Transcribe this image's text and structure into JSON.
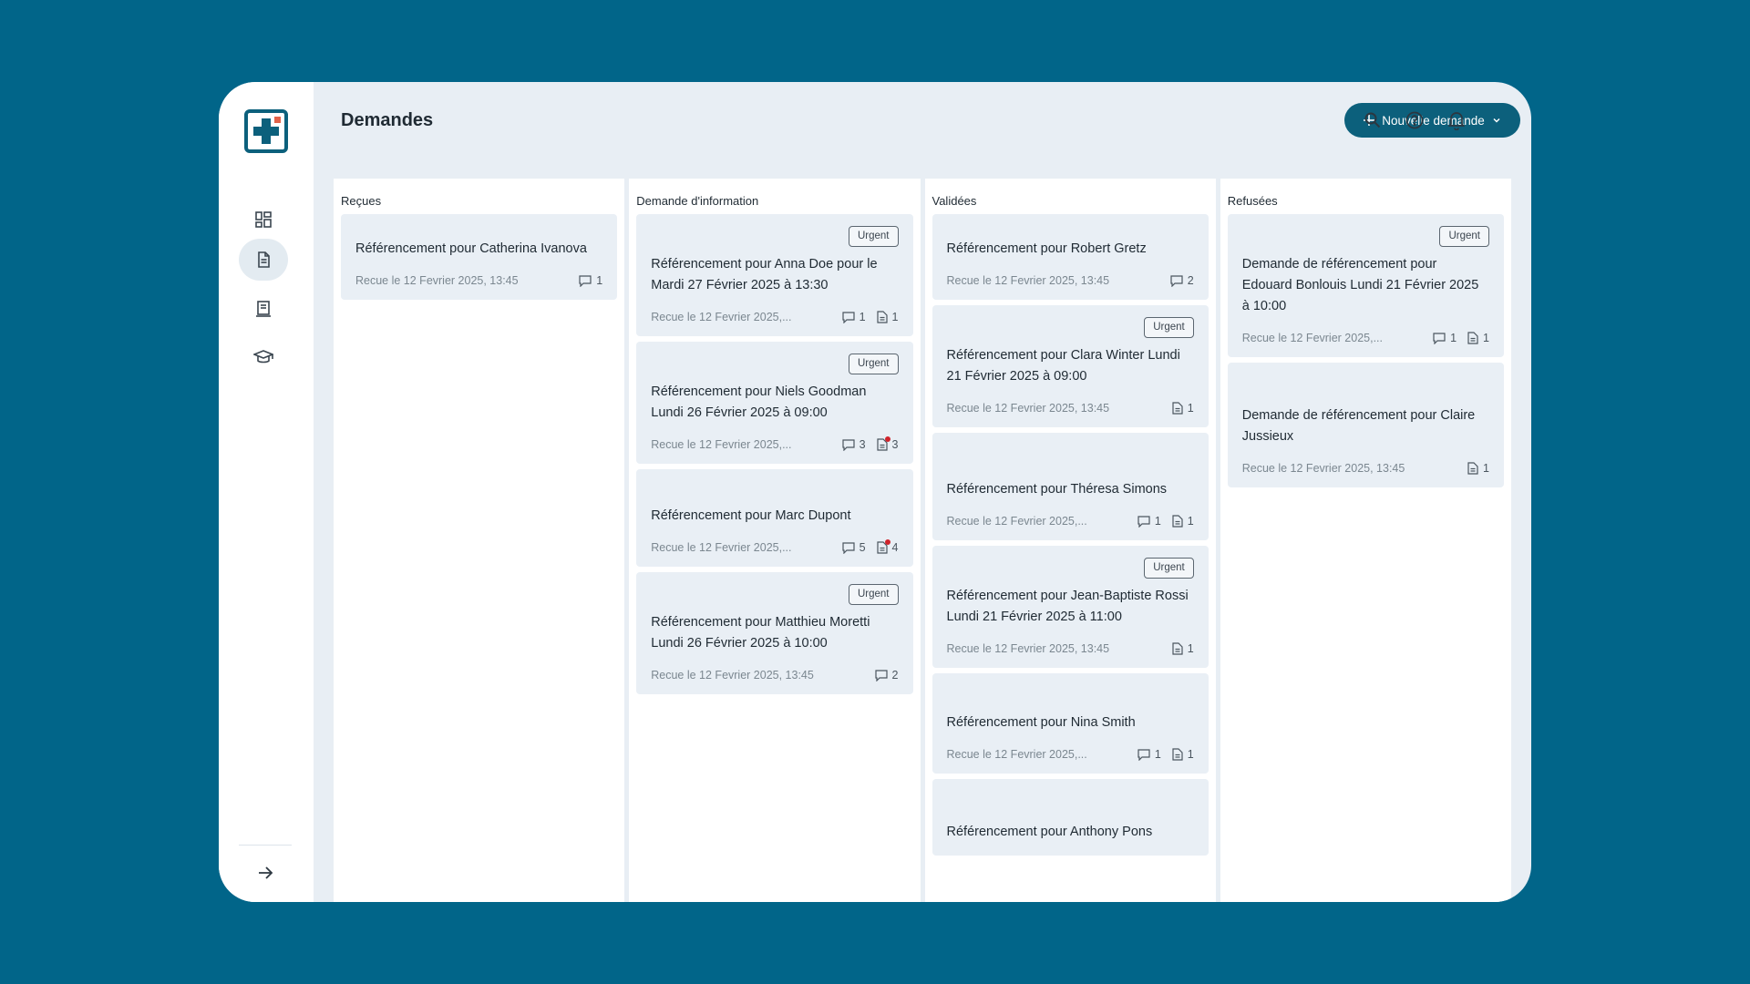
{
  "colors": {
    "background": "#016589",
    "accent": "#0c607c",
    "surface": "#e8eef4",
    "alert_dot": "#d0232b"
  },
  "header": {
    "title": "Demandes",
    "new_button_label": "Nouvelle demande"
  },
  "sidebar": {
    "items": [
      {
        "name": "dashboard",
        "icon": "grid-icon",
        "active": false
      },
      {
        "name": "demandes",
        "icon": "document-icon",
        "active": true
      },
      {
        "name": "reports",
        "icon": "newspaper-icon",
        "active": false
      },
      {
        "name": "training",
        "icon": "graduation-cap-icon",
        "active": false
      }
    ],
    "collapse_icon": "arrow-right-icon"
  },
  "columns": [
    {
      "title": "Reçues",
      "cards": [
        {
          "urgent": false,
          "title": "Référencement pour Catherina Ivanova",
          "date": "Recue le 12 Fevrier 2025, 13:45",
          "comments": "1"
        }
      ]
    },
    {
      "title": "Demande d'information",
      "cards": [
        {
          "urgent": true,
          "badge": "Urgent",
          "title": "Référencement pour Anna Doe pour le Mardi 27 Février 2025 à 13:30",
          "date": "Recue le 12 Fevrier 2025,...",
          "comments": "1",
          "docs": "1"
        },
        {
          "urgent": true,
          "badge": "Urgent",
          "title": "Référencement pour Niels Goodman Lundi 26 Février 2025 à 09:00",
          "date": "Recue le 12 Fevrier 2025,...",
          "comments": "3",
          "docs": "3",
          "docs_alert": true
        },
        {
          "urgent": false,
          "title": "Référencement pour Marc Dupont",
          "date": "Recue le 12 Fevrier 2025,...",
          "comments": "5",
          "docs": "4",
          "docs_alert": true
        },
        {
          "urgent": true,
          "badge": "Urgent",
          "title": "Référencement pour Matthieu Moretti Lundi 26 Février 2025 à 10:00",
          "date": "Recue le 12 Fevrier 2025, 13:45",
          "comments": "2"
        }
      ]
    },
    {
      "title": "Validées",
      "cards": [
        {
          "urgent": false,
          "title": "Référencement pour Robert Gretz",
          "date": "Recue le 12 Fevrier 2025, 13:45",
          "comments": "2"
        },
        {
          "urgent": true,
          "badge": "Urgent",
          "title": "Référencement pour Clara Winter Lundi 21 Février 2025 à 09:00",
          "date": "Recue le 12 Fevrier 2025, 13:45",
          "docs": "1"
        },
        {
          "urgent": false,
          "title": "Référencement pour Théresa Simons",
          "date": "Recue le 12 Fevrier 2025,...",
          "comments": "1",
          "docs": "1"
        },
        {
          "urgent": true,
          "badge": "Urgent",
          "title": "Référencement pour Jean-Baptiste Rossi Lundi 21 Février 2025 à 11:00",
          "date": "Recue le 12 Fevrier 2025, 13:45",
          "docs": "1"
        },
        {
          "urgent": false,
          "title": "Référencement pour Nina Smith",
          "date": "Recue le 12 Fevrier 2025,...",
          "comments": "1",
          "docs": "1"
        },
        {
          "urgent": false,
          "title": "Référencement pour Anthony Pons",
          "date": "",
          "partial": true
        }
      ]
    },
    {
      "title": "Refusées",
      "cards": [
        {
          "urgent": true,
          "badge": "Urgent",
          "title": "Demande de référencement pour Edouard Bonlouis Lundi 21 Février 2025 à 10:00",
          "date": "Recue le 12 Fevrier 2025,...",
          "comments": "1",
          "docs": "1"
        },
        {
          "urgent": false,
          "title": "Demande de référencement pour Claire Jussieux",
          "date": "Recue le 12 Fevrier 2025, 13:45",
          "docs": "1"
        }
      ]
    }
  ]
}
